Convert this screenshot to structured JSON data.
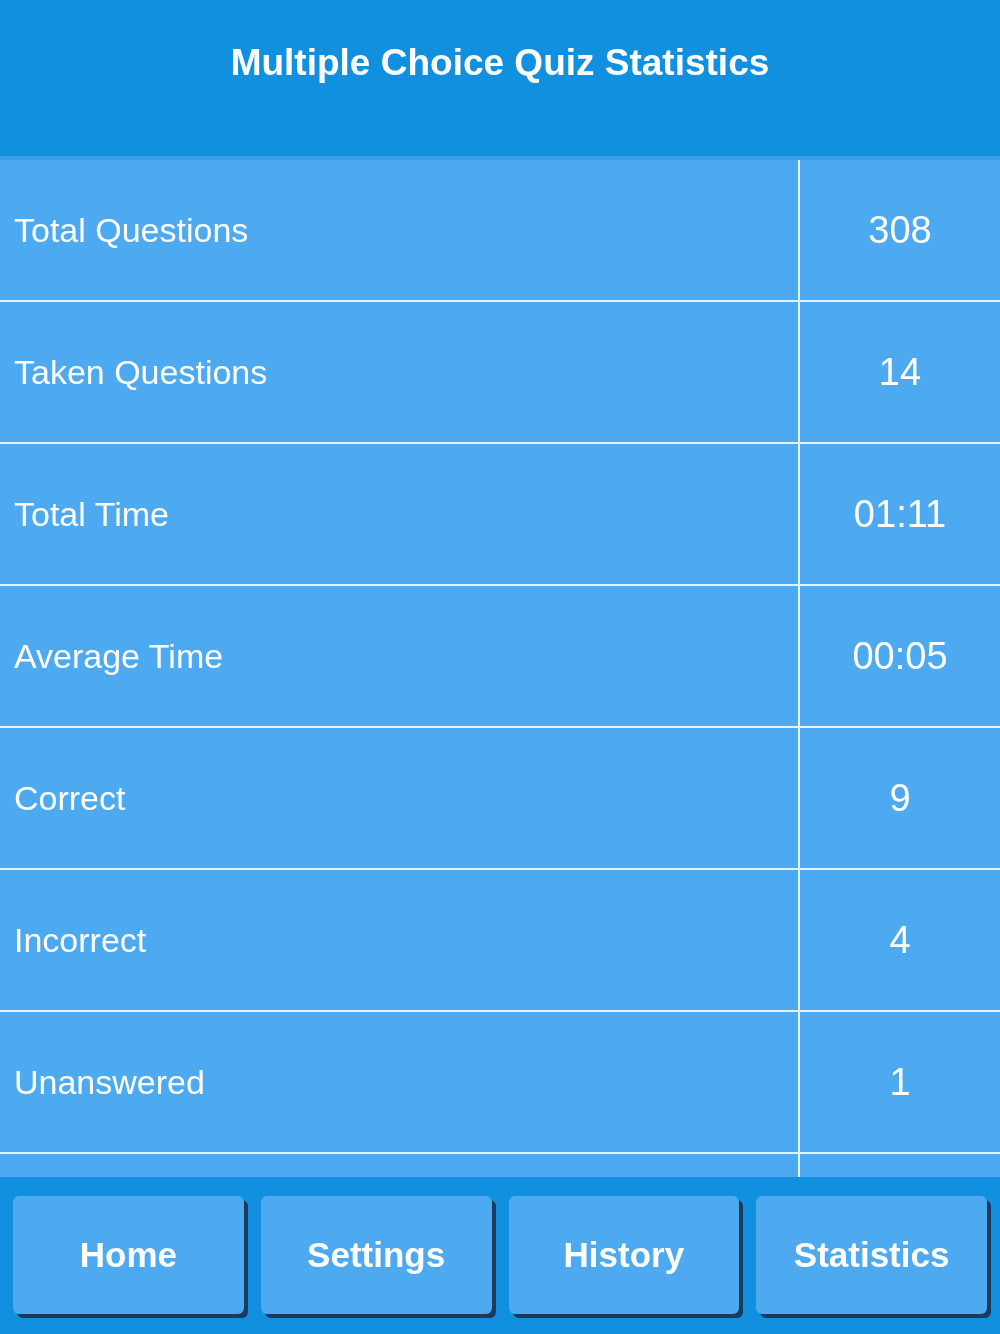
{
  "header": {
    "title": "Multiple Choice Quiz Statistics"
  },
  "stats": [
    {
      "label": "Total Questions",
      "value": "308"
    },
    {
      "label": "Taken Questions",
      "value": "14"
    },
    {
      "label": "Total Time",
      "value": "01:11"
    },
    {
      "label": "Average Time",
      "value": "00:05"
    },
    {
      "label": "Correct",
      "value": "9"
    },
    {
      "label": "Incorrect",
      "value": "4"
    },
    {
      "label": "Unanswered",
      "value": "1"
    }
  ],
  "nav_buttons": [
    "Home",
    "Settings",
    "History",
    "Statistics"
  ]
}
